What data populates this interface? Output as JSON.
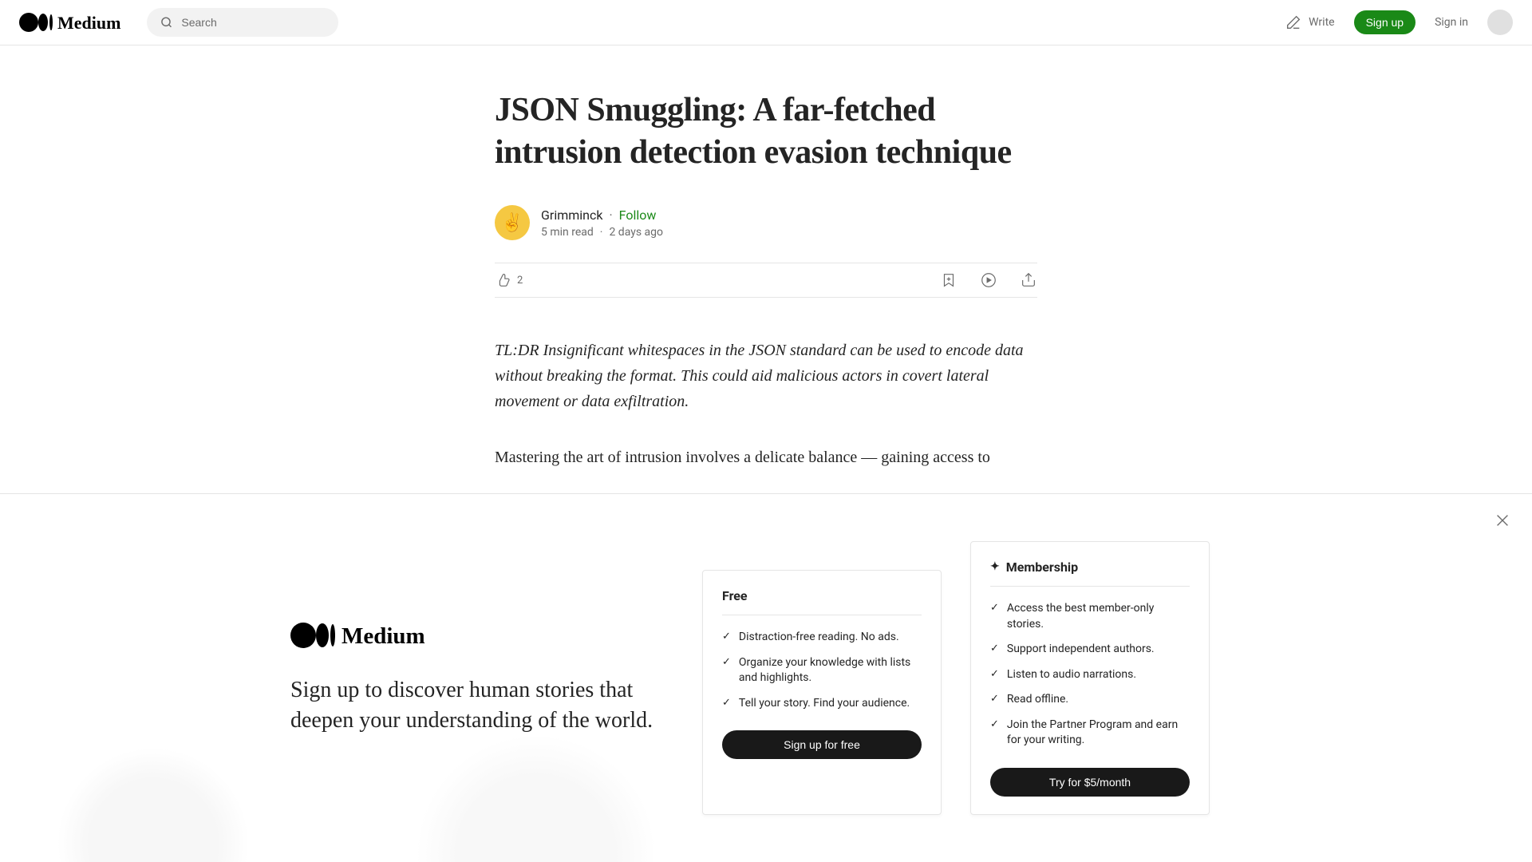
{
  "header": {
    "search_placeholder": "Search",
    "write_label": "Write",
    "signup_label": "Sign up",
    "signin_label": "Sign in"
  },
  "article": {
    "title": "JSON Smuggling: A far-fetched intrusion detection evasion technique",
    "author": "Grimminck",
    "follow_label": "Follow",
    "read_time": "5 min read",
    "date": "2 days ago",
    "clap_count": "2",
    "tldr": "TL:DR Insignificant whitespaces in the JSON standard can be used to encode data without breaking the format. This could aid malicious actors in covert lateral movement or data exfiltration.",
    "paragraph1": "Mastering the art of intrusion involves a delicate balance — gaining access to"
  },
  "banner": {
    "tagline": "Sign up to discover human stories that deepen your understanding of the world.",
    "free": {
      "title": "Free",
      "features": [
        "Distraction-free reading. No ads.",
        "Organize your knowledge with lists and highlights.",
        "Tell your story. Find your audience."
      ],
      "cta": "Sign up for free"
    },
    "membership": {
      "title": "Membership",
      "features": [
        "Access the best member-only stories.",
        "Support independent authors.",
        "Listen to audio narrations.",
        "Read offline.",
        "Join the Partner Program and earn for your writing."
      ],
      "cta": "Try for $5/month"
    }
  }
}
